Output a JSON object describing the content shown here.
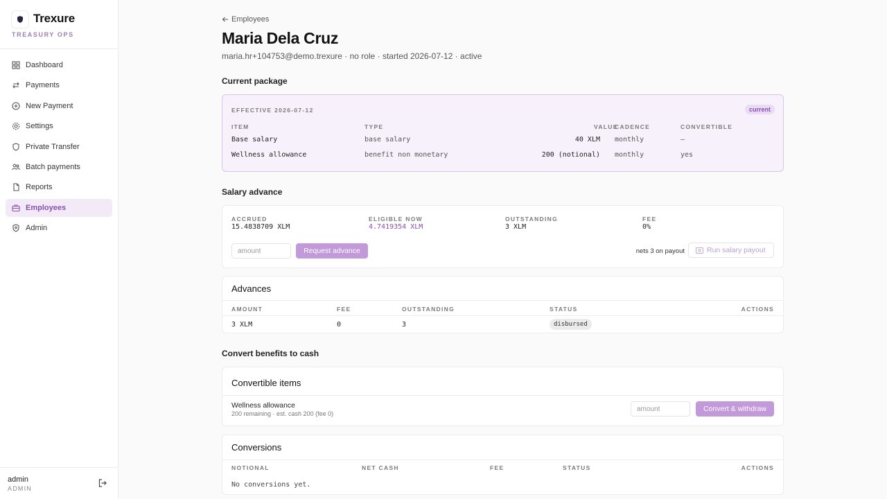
{
  "brand": {
    "name": "Trexure",
    "subtitle": "TREASURY OPS"
  },
  "nav": [
    {
      "label": "Dashboard",
      "icon": "grid-icon"
    },
    {
      "label": "Payments",
      "icon": "arrows-icon"
    },
    {
      "label": "New Payment",
      "icon": "plus-circle-icon"
    },
    {
      "label": "Settings",
      "icon": "gear-icon"
    },
    {
      "label": "Private Transfer",
      "icon": "shield-icon"
    },
    {
      "label": "Batch payments",
      "icon": "users-icon"
    },
    {
      "label": "Reports",
      "icon": "document-icon"
    },
    {
      "label": "Employees",
      "icon": "briefcase-icon",
      "active": true
    },
    {
      "label": "Admin",
      "icon": "admin-icon"
    }
  ],
  "user": {
    "name": "admin",
    "role": "ADMIN"
  },
  "header": {
    "back_label": "Employees",
    "title": "Maria Dela Cruz",
    "subtitle": "maria.hr+104753@demo.trexure · no role · started 2026-07-12 · active"
  },
  "package": {
    "heading": "Current package",
    "effective": "EFFECTIVE 2026-07-12",
    "badge": "current",
    "columns": {
      "item": "ITEM",
      "type": "TYPE",
      "value": "VALUE",
      "cadence": "CADENCE",
      "convertible": "CONVERTIBLE"
    },
    "rows": [
      {
        "item": "Base salary",
        "type": "base salary",
        "value": "40 XLM",
        "cadence": "monthly",
        "convertible": "—"
      },
      {
        "item": "Wellness allowance",
        "type": "benefit non monetary",
        "value": "200 (notional)",
        "cadence": "monthly",
        "convertible": "yes"
      }
    ]
  },
  "advance": {
    "heading": "Salary advance",
    "accrued_label": "ACCRUED",
    "accrued": "15.4838709 XLM",
    "eligible_label": "ELIGIBLE NOW",
    "eligible": "4.7419354 XLM",
    "outstanding_label": "OUTSTANDING",
    "outstanding": "3 XLM",
    "fee_label": "FEE",
    "fee": "0%",
    "amount_placeholder": "amount",
    "request_label": "Request advance",
    "nets_text": "nets 3 on payout",
    "run_payout_label": "Run salary payout"
  },
  "advances": {
    "title": "Advances",
    "columns": {
      "amount": "AMOUNT",
      "fee": "FEE",
      "outstanding": "OUTSTANDING",
      "status": "STATUS",
      "actions": "ACTIONS"
    },
    "rows": [
      {
        "amount": "3 XLM",
        "fee": "0",
        "outstanding": "3",
        "status": "disbursed"
      }
    ]
  },
  "convert": {
    "heading": "Convert benefits to cash",
    "card_title": "Convertible items",
    "item_name": "Wellness allowance",
    "item_detail": "200 remaining · est. cash 200 (fee 0)",
    "amount_placeholder": "amount",
    "convert_label": "Convert & withdraw"
  },
  "conversions": {
    "title": "Conversions",
    "columns": {
      "notional": "NOTIONAL",
      "net_cash": "NET CASH",
      "fee": "FEE",
      "status": "STATUS",
      "actions": "ACTIONS"
    },
    "empty": "No conversions yet."
  }
}
